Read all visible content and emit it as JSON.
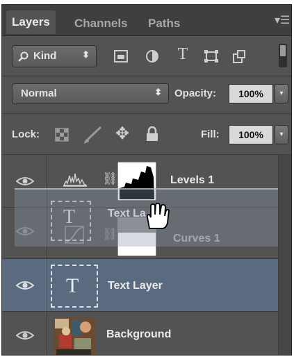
{
  "tabs": [
    {
      "label": "Layers",
      "active": true
    },
    {
      "label": "Channels",
      "active": false
    },
    {
      "label": "Paths",
      "active": false
    }
  ],
  "filter": {
    "kind_label": "Kind",
    "icons": [
      "image-filter-icon",
      "adjustment-filter-icon",
      "type-filter-icon",
      "shape-filter-icon",
      "smart-object-filter-icon",
      "filter-toggle-icon"
    ]
  },
  "blend": {
    "mode": "Normal",
    "opacity_label": "Opacity:",
    "opacity_value": "100%"
  },
  "lock": {
    "label": "Lock:",
    "icons": [
      "lock-transparent-icon",
      "lock-image-icon",
      "lock-position-icon",
      "lock-all-icon"
    ],
    "fill_label": "Fill:",
    "fill_value": "100%"
  },
  "layers": [
    {
      "name": "Levels 1",
      "type": "adjustment",
      "icon": "levels-adjustment-icon",
      "visible": true,
      "selected": false
    },
    {
      "name": "Curves 1",
      "type": "adjustment",
      "icon": "curves-adjustment-icon",
      "visible": true,
      "selected": false,
      "dimmed": true
    },
    {
      "name": "Text Layer",
      "type": "text",
      "visible": true,
      "selected": true
    },
    {
      "name": "Background",
      "type": "image",
      "visible": true,
      "selected": false
    }
  ],
  "drag_ghost": {
    "label": "Text La"
  },
  "colors": {
    "panel": "#535353",
    "selected": "#5a6b80",
    "tab_bar": "#3f3f3f"
  }
}
